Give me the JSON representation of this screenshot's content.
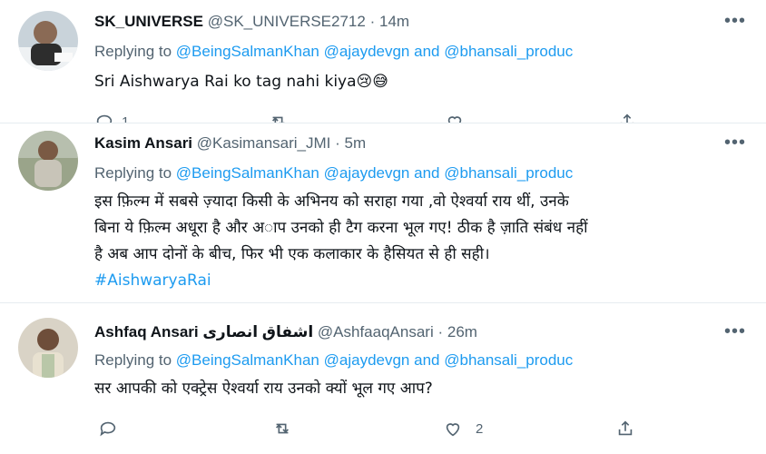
{
  "tweets": [
    {
      "name": "SK_UNIVERSE",
      "handle": "@SK_UNIVERSE2712",
      "time": "14m",
      "replying_prefix": "Replying to",
      "mentions": [
        "@BeingSalmanKhan",
        "@ajaydevgn",
        "@bhansali_produc"
      ],
      "and_word": "and",
      "text": "Sri Aishwarya Rai ko tag nahi kiya😢😅",
      "reply_count": "1"
    },
    {
      "name": "Kasim Ansari",
      "handle": "@Kasimansari_JMI",
      "time": "5m",
      "replying_prefix": "Replying to",
      "mentions": [
        "@BeingSalmanKhan",
        "@ajaydevgn",
        "@bhansali_produc"
      ],
      "and_word": "and",
      "text_line1": "इस फ़िल्म में सबसे ज़्यादा किसी के अभिनय को सराहा गया ,वो ऐश्वर्या राय थीं, उनके",
      "text_line2": "बिना ये फ़िल्म अधूरा है और अाप उनको ही टैग करना भूल गए! ठीक है ज़ाति संबंध नहीं",
      "text_line3": "है अब आप दोनों के बीच, फिर भी एक कलाकार के हैसियत से ही सही।",
      "hashtag": "#AishwaryaRai"
    },
    {
      "name": "Ashfaq Ansari اشفاق انصاری",
      "handle": "@AshfaaqAnsari",
      "time": "26m",
      "replying_prefix": "Replying to",
      "mentions": [
        "@BeingSalmanKhan",
        "@ajaydevgn",
        "@bhansali_produc"
      ],
      "and_word": "and",
      "text": "सर आपकी को एक्ट्रेस ऐश्वर्या राय उनको क्यों भूल गए आप?",
      "like_count": "2"
    }
  ],
  "more_glyph": "•••",
  "separator": "·",
  "icons": [
    "reply-icon",
    "retweet-icon",
    "like-icon",
    "share-icon",
    "more-icon"
  ]
}
